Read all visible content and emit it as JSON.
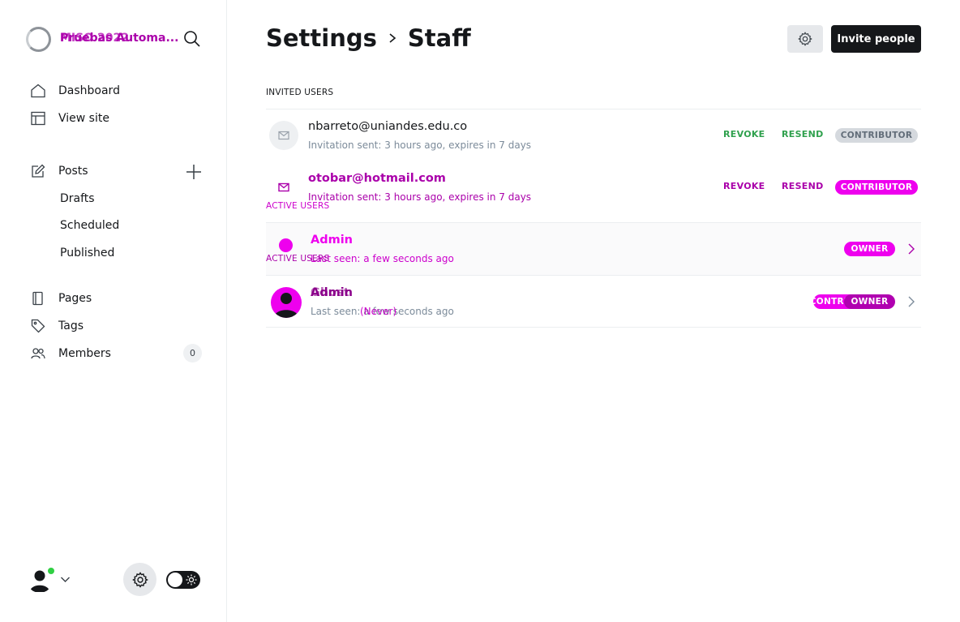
{
  "sidebar": {
    "brand_name": "Pruebas Automa...",
    "brand_name_overlay": "MISO 2022",
    "nav": {
      "dashboard": "Dashboard",
      "view_site": "View site",
      "posts": "Posts",
      "drafts": "Drafts",
      "scheduled": "Scheduled",
      "published": "Published",
      "pages": "Pages",
      "tags": "Tags",
      "members": "Members",
      "members_count": "0"
    }
  },
  "header": {
    "title": "Settings",
    "subtitle": "Staff",
    "invite_button": "Invite people"
  },
  "invited": {
    "label": "INVITED USERS",
    "users": [
      {
        "email": "nbarreto@uniandes.edu.co",
        "status": "Invitation sent: 3 hours ago, expires in 7 days",
        "revoke": "REVOKE",
        "resend": "RESEND",
        "role": "CONTRIBUTOR"
      },
      {
        "email": "otobar@hotmail.com",
        "status": "Invitation sent: 3 hours ago, expires in 7 days",
        "revoke": "REVOKE",
        "resend": "RESEND",
        "role": "CONTRIBUTOR"
      }
    ]
  },
  "active": {
    "label": "ACTIVE USERS",
    "users": [
      {
        "name": "Admin",
        "last_seen": "Last seen: a few seconds ago",
        "role": "OWNER"
      },
      {
        "name": "Admin",
        "name_overlay": "Ghost",
        "last_seen": "Last seen: a few seconds ago",
        "last_seen_overlay": "(Never)",
        "role": "OWNER",
        "role_overlay": "CONTRIBUTOR"
      }
    ]
  },
  "colors": {
    "accent_green": "#30a14e",
    "overlay_magenta": "#ee00ee",
    "online": "#30cf43"
  }
}
